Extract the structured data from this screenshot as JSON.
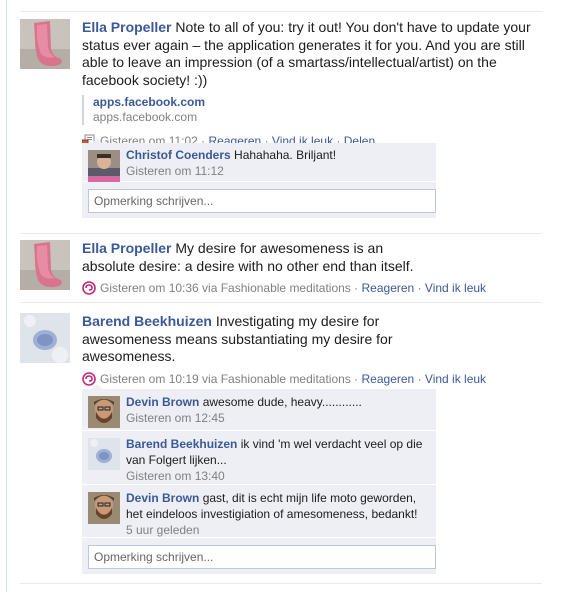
{
  "stories": [
    {
      "actor": "Ella Propeller",
      "message": "Note to all of you: try it out! You don't have to update your status ever again – the application generates it for you. And you are still able to leave an impression (of a smartass/intellectual/artist) on the facebook society! :))",
      "attachment": {
        "title": "apps.facebook.com",
        "url": "apps.facebook.com"
      },
      "time": "Gisteren om 11:02",
      "actions": [
        "Reageren",
        "Vind ik leuk",
        "Delen"
      ],
      "icon": "share-link-icon",
      "comments": [
        {
          "author": "Christof Coenders",
          "text": "Hahahaha. Briljant!",
          "time": "Gisteren om 11:12"
        }
      ],
      "comment_placeholder": "Opmerking schrijven..."
    },
    {
      "actor": "Ella Propeller",
      "message": "My desire for awesomeness is an absolute desire: a desire with no other end than itself.",
      "time": "Gisteren om 10:36 via Fashionable meditations",
      "actions": [
        "Reageren",
        "Vind ik leuk"
      ],
      "icon": "app-swirl-icon"
    },
    {
      "actor": "Barend Beekhuizen",
      "message": "Investigating my desire for awesomeness means substantiating my desire for awesomeness.",
      "time": "Gisteren om 10:19 via Fashionable meditations",
      "actions": [
        "Reageren",
        "Vind ik leuk"
      ],
      "icon": "app-swirl-icon",
      "comments": [
        {
          "author": "Devin Brown",
          "text": "awesome dude, heavy............",
          "time": "Gisteren om 12:45"
        },
        {
          "author": "Barend Beekhuizen",
          "text": "ik vind 'm wel verdacht veel op die van Folgert lijken...",
          "time": "Gisteren om 13:40"
        },
        {
          "author": "Devin Brown",
          "text": "gast, dit is echt mijn life moto geworden, het eindeloos investigiation of amesomeness, bedankt!",
          "time": "5 uur geleden"
        }
      ],
      "comment_placeholder": "Opmerking schrijven..."
    }
  ],
  "colors": {
    "link": "#3b5998",
    "meta": "#808080",
    "comment_bg": "#edeff4",
    "app_icon": "#c0287a"
  }
}
